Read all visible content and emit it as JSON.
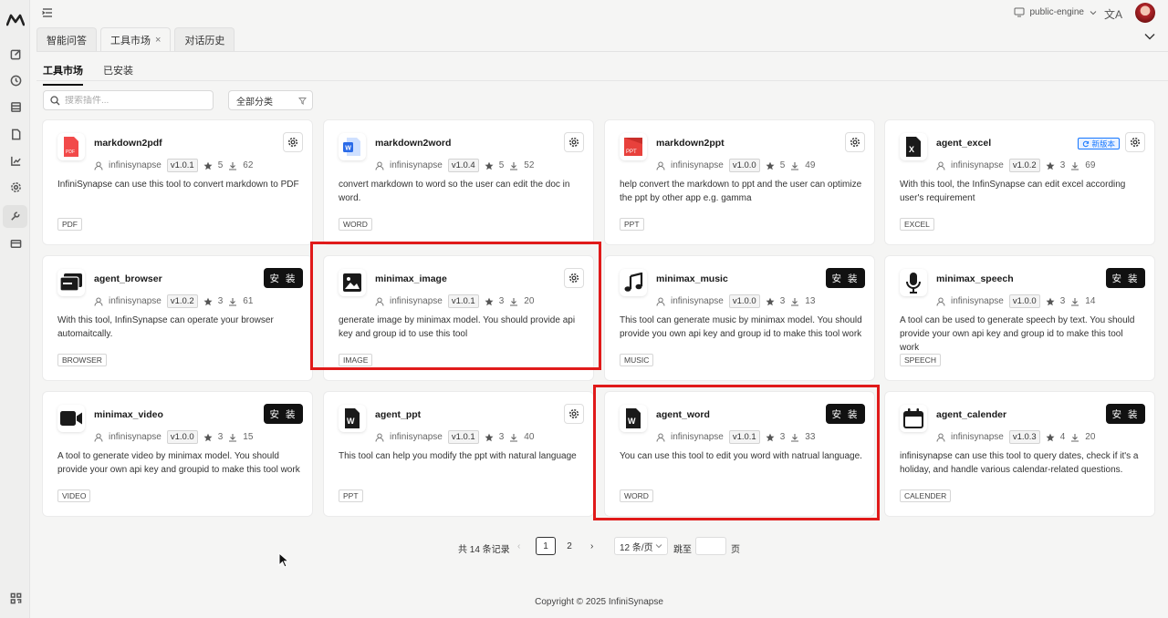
{
  "topbar": {
    "engine": "public-engine",
    "translate_glyph": "文A"
  },
  "tabs": [
    {
      "label": "智能问答"
    },
    {
      "label": "工具市场",
      "close": "×"
    },
    {
      "label": "对话历史"
    }
  ],
  "subtabs": [
    "工具市场",
    "已安装"
  ],
  "filters": {
    "search_placeholder": "搜索插件...",
    "category": "全部分类"
  },
  "install_label": "安 装",
  "new_version_label": "新版本",
  "cards": [
    {
      "name": "markdown2pdf",
      "author": "infinisynapse",
      "version": "v1.0.1",
      "stars": "5",
      "downloads": "62",
      "desc": "InfiniSynapse can use this tool to convert markdown to PDF",
      "tag": "PDF",
      "action": "settings",
      "icon": "pdf-icon"
    },
    {
      "name": "markdown2word",
      "author": "infinisynapse",
      "version": "v1.0.4",
      "stars": "5",
      "downloads": "52",
      "desc": "convert markdown to word so the user can edit the doc in word.",
      "tag": "WORD",
      "action": "settings",
      "icon": "word-doc-icon"
    },
    {
      "name": "markdown2ppt",
      "author": "infinisynapse",
      "version": "v1.0.0",
      "stars": "5",
      "downloads": "49",
      "desc": "help convert the markdown to ppt and the user can optimize the ppt by other app e.g. gamma",
      "tag": "PPT",
      "action": "settings",
      "icon": "ppt-icon"
    },
    {
      "name": "agent_excel",
      "author": "infinisynapse",
      "version": "v1.0.2",
      "stars": "3",
      "downloads": "69",
      "desc": "With this tool, the InfinSynapse can edit excel according user's requirement",
      "tag": "EXCEL",
      "action": "settings",
      "badge": true,
      "icon": "excel-icon"
    },
    {
      "name": "agent_browser",
      "author": "infinisynapse",
      "version": "v1.0.2",
      "stars": "3",
      "downloads": "61",
      "desc": "With this tool, InfinSynapse can operate your browser automaitcally.",
      "tag": "BROWSER",
      "action": "install",
      "icon": "browser-icon"
    },
    {
      "name": "minimax_image",
      "author": "infinisynapse",
      "version": "v1.0.1",
      "stars": "3",
      "downloads": "20",
      "desc": "generate image by minimax model. You should provide api key and group id to use this tool",
      "tag": "IMAGE",
      "action": "settings",
      "icon": "image-icon"
    },
    {
      "name": "minimax_music",
      "author": "infinisynapse",
      "version": "v1.0.0",
      "stars": "3",
      "downloads": "13",
      "desc": "This tool can generate music by minimax model. You should provide you own api key and group id to make this tool work",
      "tag": "MUSIC",
      "action": "install",
      "icon": "music-icon"
    },
    {
      "name": "minimax_speech",
      "author": "infinisynapse",
      "version": "v1.0.0",
      "stars": "3",
      "downloads": "14",
      "desc": "A tool can be used to generate speech by text. You should provide your own api key and group id to make this tool work",
      "tag": "SPEECH",
      "action": "install",
      "icon": "microphone-icon"
    },
    {
      "name": "minimax_video",
      "author": "infinisynapse",
      "version": "v1.0.0",
      "stars": "3",
      "downloads": "15",
      "desc": "A tool to generate video by minimax model. You should provide your own api key and groupid to make this tool work",
      "tag": "VIDEO",
      "action": "install",
      "icon": "video-camera-icon"
    },
    {
      "name": "agent_ppt",
      "author": "infinisynapse",
      "version": "v1.0.1",
      "stars": "3",
      "downloads": "40",
      "desc": "This tool can help you modify the ppt with natural language",
      "tag": "PPT",
      "action": "settings",
      "icon": "word-file-icon"
    },
    {
      "name": "agent_word",
      "author": "infinisynapse",
      "version": "v1.0.1",
      "stars": "3",
      "downloads": "33",
      "desc": "You can use this tool to edit you word with natrual language.",
      "tag": "WORD",
      "action": "install",
      "icon": "word-file-icon"
    },
    {
      "name": "agent_calender",
      "author": "infinisynapse",
      "version": "v1.0.3",
      "stars": "4",
      "downloads": "20",
      "desc": "infinisynapse can use this tool to query dates, check if it's a holiday, and handle various calendar-related questions.",
      "tag": "CALENDER",
      "action": "install",
      "icon": "calendar-icon"
    }
  ],
  "pagination": {
    "total": "共 14 条记录",
    "prev": "‹",
    "pages": [
      "1",
      "2"
    ],
    "next": "›",
    "page_size": "12 条/页",
    "jump_label": "跳至",
    "page_unit": "页"
  },
  "footer": "Copyright © 2025 InfiniSynapse",
  "colors": {
    "highlight": "#e01a1a",
    "accent": "#1677ff",
    "install_bg": "#111111"
  }
}
